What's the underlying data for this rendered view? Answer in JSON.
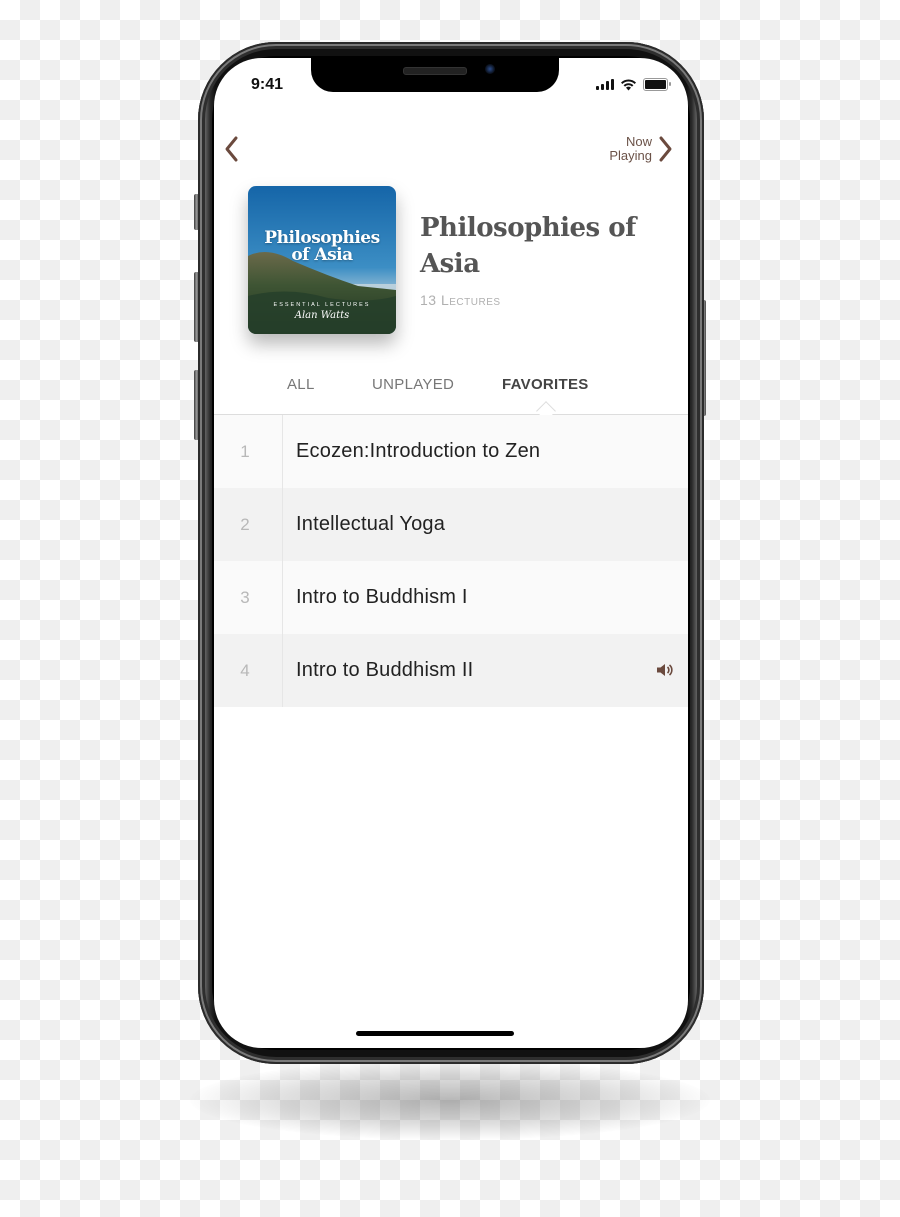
{
  "status_bar": {
    "time": "9:41",
    "icons": [
      "cellular-signal-icon",
      "wifi-icon",
      "battery-icon"
    ]
  },
  "nav": {
    "back_icon": "chevron-left-icon",
    "now_playing_label": "Now Playing",
    "now_playing_icon": "chevron-right-icon",
    "accent_color": "#6b4a3e"
  },
  "album": {
    "cover_title_line1": "Philosophies",
    "cover_title_line2": "of Asia",
    "cover_subtitle": "ESSENTIAL LECTURES",
    "cover_signature": "Alan Watts",
    "title": "Philosophies of Asia",
    "lecture_count": "13 Lectures"
  },
  "tabs": [
    {
      "label": "ALL",
      "active": false
    },
    {
      "label": "UNPLAYED",
      "active": false
    },
    {
      "label": "FAVORITES",
      "active": true
    }
  ],
  "lectures": [
    {
      "number": "1",
      "title": "Ecozen:Introduction to Zen",
      "playing": false
    },
    {
      "number": "2",
      "title": "Intellectual Yoga",
      "playing": false
    },
    {
      "number": "3",
      "title": "Intro to Buddhism I",
      "playing": false
    },
    {
      "number": "4",
      "title": "Intro to Buddhism II",
      "playing": true,
      "icon": "speaker-volume-icon"
    }
  ]
}
